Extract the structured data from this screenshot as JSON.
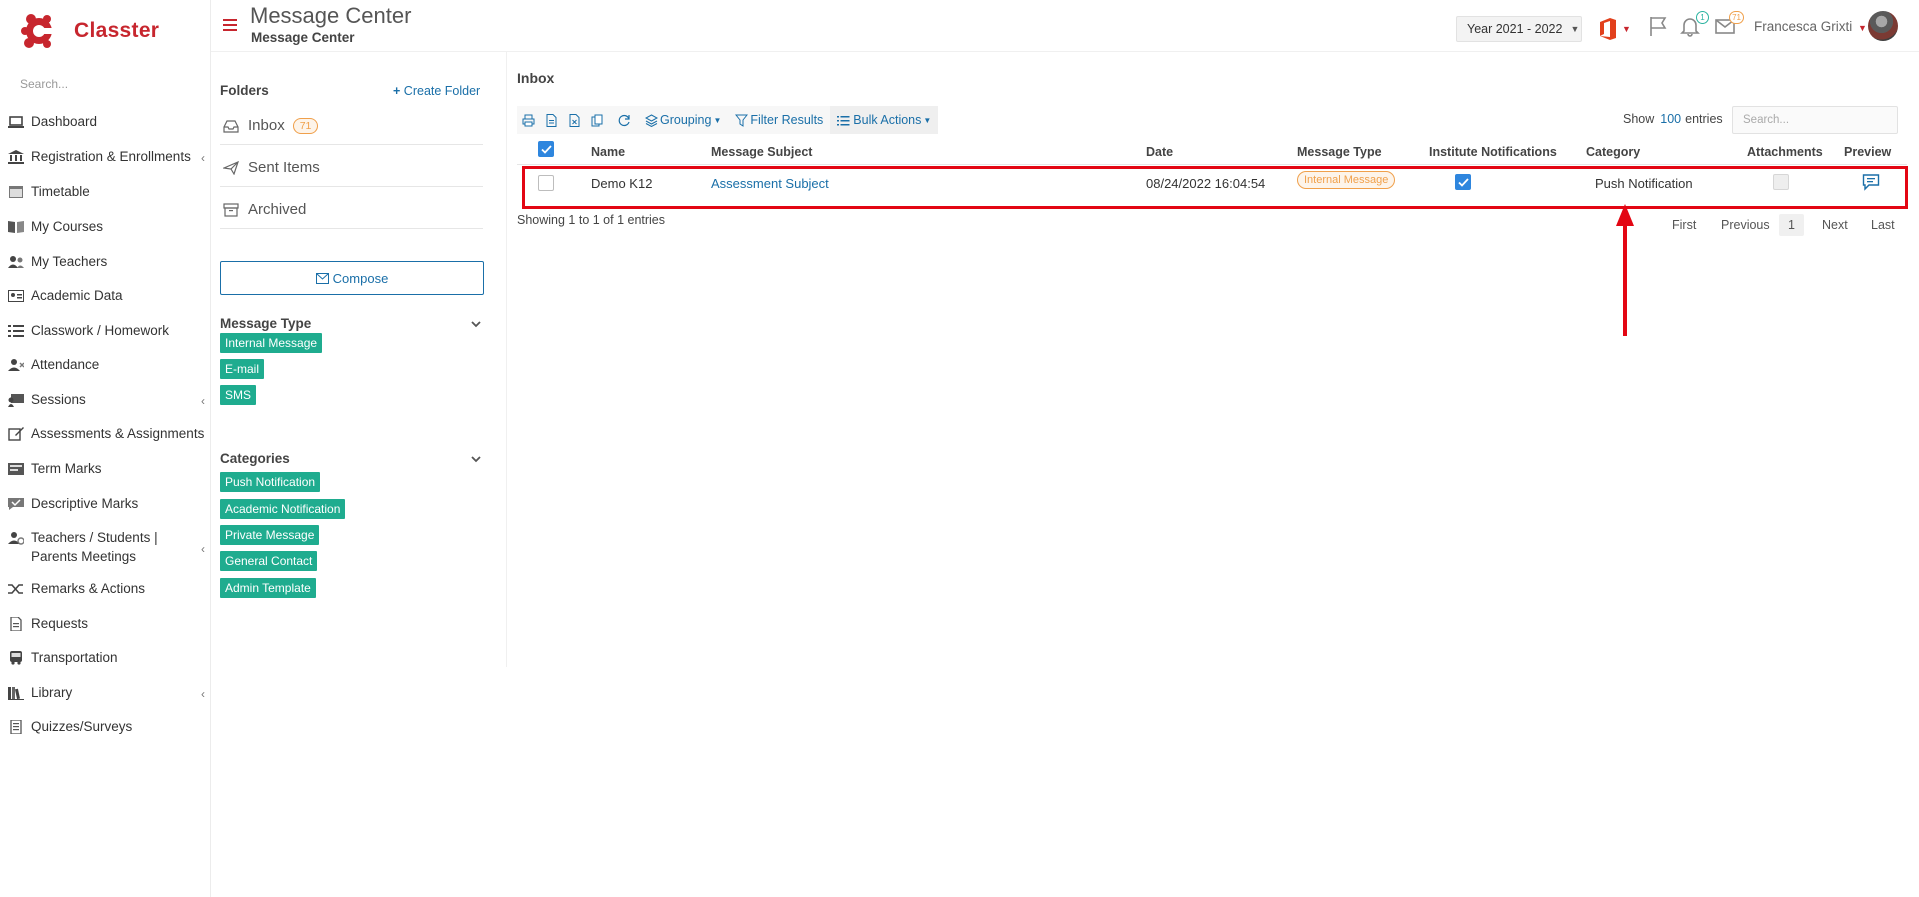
{
  "brand": {
    "name": "Classter"
  },
  "nav": {
    "search_placeholder": "Search...",
    "items": [
      {
        "label": "Dashboard",
        "icon": "laptop-icon"
      },
      {
        "label": "Registration & Enrollments",
        "icon": "institution-icon"
      },
      {
        "label": "Timetable",
        "icon": "calendar-icon"
      },
      {
        "label": "My Courses",
        "icon": "book-icon"
      },
      {
        "label": "My Teachers",
        "icon": "users-icon"
      },
      {
        "label": "Academic Data",
        "icon": "id-card-icon"
      },
      {
        "label": "Classwork / Homework",
        "icon": "list-check-icon"
      },
      {
        "label": "Attendance",
        "icon": "user-x-icon"
      },
      {
        "label": "Sessions",
        "icon": "chalkboard-icon"
      },
      {
        "label": "Assessments & Assignments",
        "icon": "edit-icon"
      },
      {
        "label": "Term Marks",
        "icon": "grade-icon"
      },
      {
        "label": "Descriptive Marks",
        "icon": "comment-check-icon"
      },
      {
        "label": "Teachers / Students | Parents Meetings",
        "icon": "meeting-icon"
      },
      {
        "label": "Remarks & Actions",
        "icon": "random-icon"
      },
      {
        "label": "Requests",
        "icon": "file-icon"
      },
      {
        "label": "Transportation",
        "icon": "bus-icon"
      },
      {
        "label": "Library",
        "icon": "library-icon"
      },
      {
        "label": "Quizzes/Surveys",
        "icon": "quiz-icon"
      }
    ]
  },
  "header": {
    "title": "Message Center",
    "subtitle": "Message Center",
    "year": "Year 2021 - 2022",
    "notifications_count": "1",
    "messages_count": "71",
    "user": "Francesca Grixti"
  },
  "folders": {
    "title": "Folders",
    "create_label": "Create Folder",
    "items": [
      {
        "label": "Inbox",
        "count": "71",
        "icon": "inbox-icon"
      },
      {
        "label": "Sent Items",
        "icon": "send-icon"
      },
      {
        "label": "Archived",
        "icon": "archive-icon"
      }
    ],
    "compose_label": "Compose"
  },
  "message_types": {
    "title": "Message Type",
    "tags": [
      "Internal Message",
      "E-mail",
      "SMS"
    ]
  },
  "categories": {
    "title": "Categories",
    "tags": [
      "Push Notification",
      "Academic Notification",
      "Private Message",
      "General Contact",
      "Admin Template"
    ]
  },
  "inbox": {
    "title": "Inbox",
    "toolbar": {
      "grouping": "Grouping",
      "filter": "Filter Results",
      "bulk": "Bulk Actions"
    },
    "show_label": "Show",
    "show_count": "100",
    "entries_label": "entries",
    "search_placeholder": "Search...",
    "columns": [
      "Name",
      "Message Subject",
      "Date",
      "Message Type",
      "Institute Notifications",
      "Category",
      "Attachments",
      "Preview"
    ],
    "rows": [
      {
        "name": "Demo K12",
        "subject": "Assessment Subject",
        "date": "08/24/2022 16:04:54",
        "type": "Internal Message",
        "institute_notifications": true,
        "category": "Push Notification",
        "attachments": false
      }
    ],
    "showing_text": "Showing 1 to 1 of 1 entries",
    "pager": {
      "first": "First",
      "previous": "Previous",
      "page": "1",
      "next": "Next",
      "last": "Last"
    }
  },
  "colors": {
    "brand": "#c7262e",
    "link": "#1a6fa8",
    "tag": "#1fac8f",
    "badge": "#f0a04b",
    "highlight": "#e30613"
  }
}
